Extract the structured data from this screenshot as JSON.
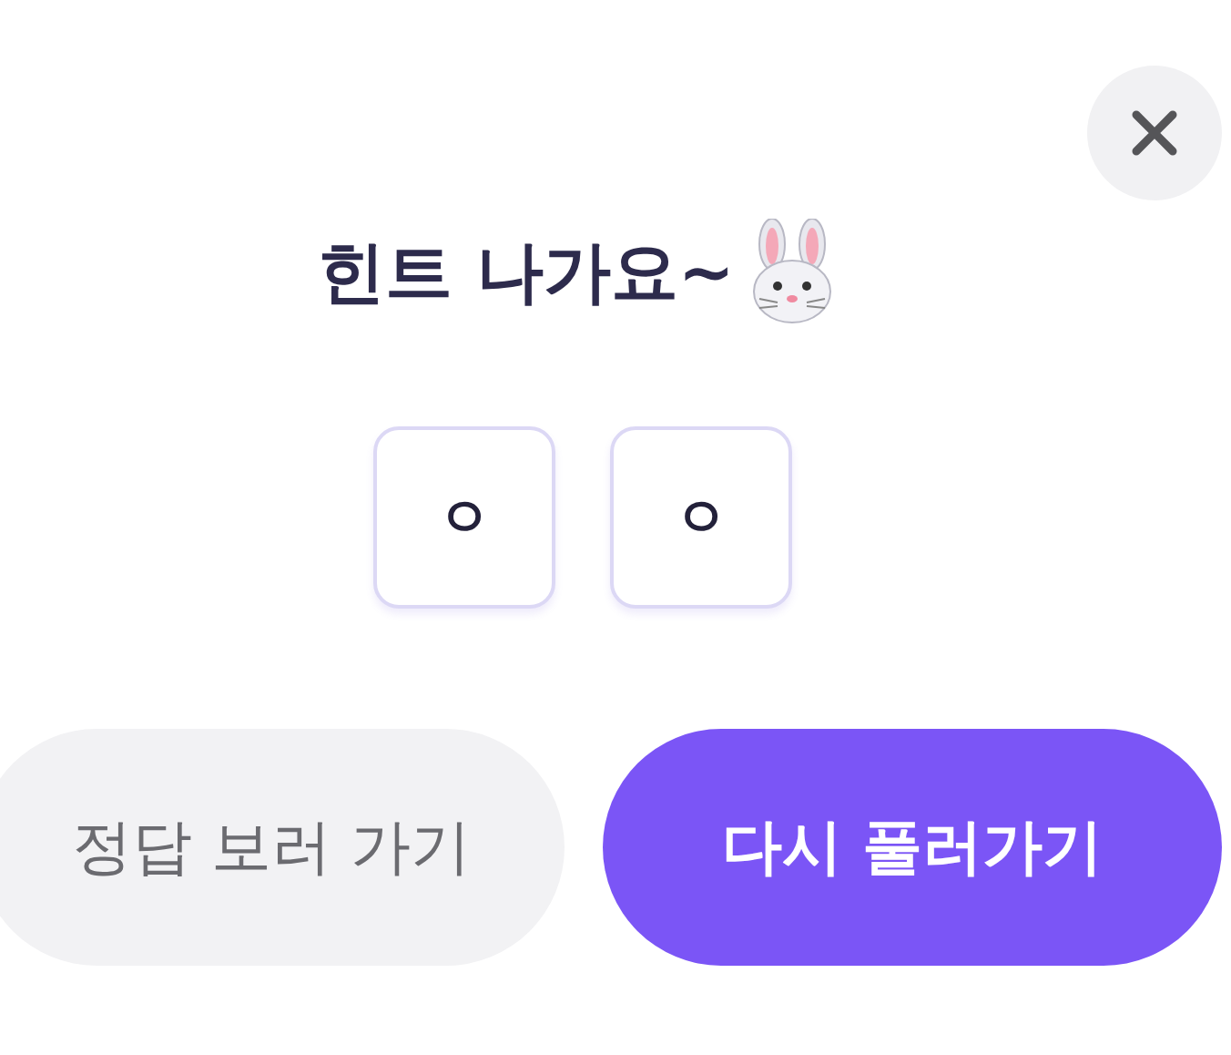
{
  "title": "힌트 나가요~",
  "hint_letters": [
    "ㅇ",
    "ㅇ"
  ],
  "buttons": [
    {
      "label": "정답 보러 가기",
      "kind": "secondary"
    },
    {
      "label": "다시 풀러가기",
      "kind": "primary"
    }
  ]
}
